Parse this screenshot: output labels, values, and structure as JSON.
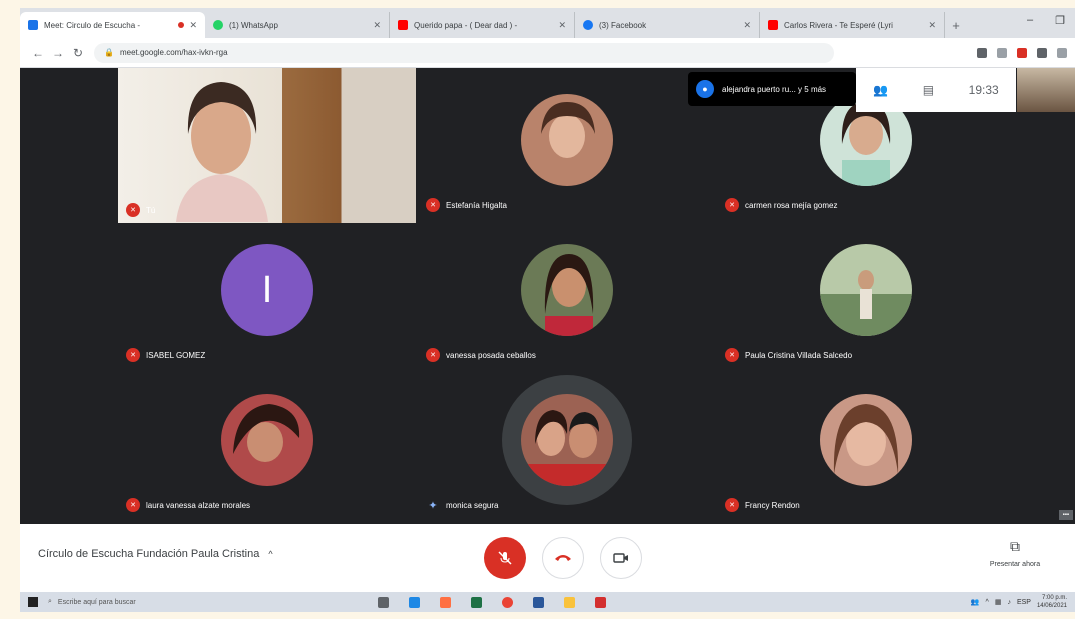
{
  "browser": {
    "tabs": [
      {
        "title": "Meet: Circulo de Escucha -",
        "color": "#1a73e8",
        "active": true,
        "recording": true
      },
      {
        "title": "(1) WhatsApp",
        "color": "#25d366",
        "active": false
      },
      {
        "title": "Querido papa - ( Dear dad ) -",
        "color": "#ff0000",
        "active": false
      },
      {
        "title": "(3) Facebook",
        "color": "#1877f2",
        "active": false
      },
      {
        "title": "Carlos Rivera - Te Esperé (Lyri",
        "color": "#ff0000",
        "active": false
      }
    ],
    "new_tab": "+",
    "window_controls": [
      "–",
      "❐",
      "✕"
    ],
    "url": "meet.google.com/hax-ivkn-rga",
    "nav": {
      "back": "←",
      "forward": "→",
      "reload": "↻"
    }
  },
  "meet": {
    "self_label": "Tú",
    "notification": {
      "icon": "👤",
      "text": "alejandra puerto ru... y 5 más"
    },
    "clock": "19:33",
    "participants": [
      {
        "name": "Estefanía Higalta",
        "avatar_color": "#b9836b"
      },
      {
        "name": "carmen rosa mejía gomez",
        "avatar_color": "#a47f65"
      },
      {
        "name": "ISABEL GOMEZ",
        "avatar_letter": "I",
        "avatar_color": "#7e57c2"
      },
      {
        "name": "vanessa posada ceballos",
        "avatar_color": "#8a5a44"
      },
      {
        "name": "Paula Cristina Villada Salcedo",
        "avatar_color": "#6f8b60"
      },
      {
        "name": "laura vanessa alzate morales",
        "avatar_color": "#b04a4a"
      },
      {
        "name": "monica segura",
        "avatar_color": "#9c6253",
        "speaking": true
      },
      {
        "name": "Francy Rendon",
        "avatar_color": "#c99886"
      }
    ],
    "meeting_name": "Círculo de Escucha Fundación Paula Cristina",
    "present_label": "Presentar ahora"
  },
  "taskbar": {
    "search_placeholder": "Escribe aquí para buscar",
    "time": "7:00 p.m.",
    "date": "14/06/2021",
    "lang": "ESP"
  }
}
